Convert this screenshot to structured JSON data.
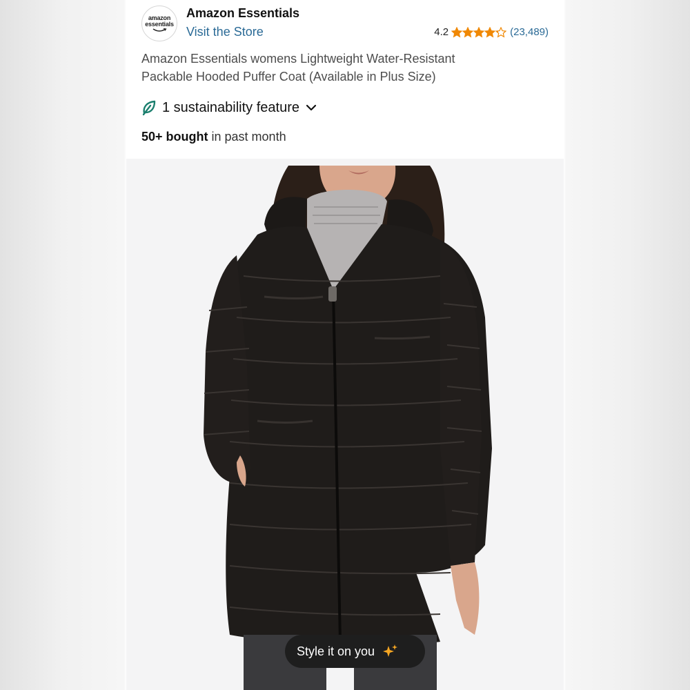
{
  "brand": {
    "logo_line1": "amazon",
    "logo_line2": "essentials",
    "name": "Amazon Essentials",
    "store_link": "Visit the Store"
  },
  "rating": {
    "value": "4.2",
    "stars": 4.2,
    "max_stars": 5,
    "review_count": "(23,489)",
    "star_color": "#f08804"
  },
  "product": {
    "title_line1": "Amazon Essentials womens Lightweight Water-Resistant",
    "title_line2": "Packable Hooded Puffer Coat (Available in Plus Size)"
  },
  "sustainability": {
    "label": "1 sustainability feature",
    "icon": "leaf-icon",
    "expand_icon": "chevron-down-icon"
  },
  "purchases": {
    "bold": "50+ bought",
    "rest": " in past month"
  },
  "image": {
    "description_icon": "product-photo-black-puffer-coat"
  },
  "style_button": {
    "label": "Style it on you",
    "icon": "sparkle-icon"
  },
  "colors": {
    "link": "#2a6a96",
    "coat": "#1f1c1a",
    "button_bg": "#1e1e1e",
    "sparkle": "#f5a623"
  }
}
